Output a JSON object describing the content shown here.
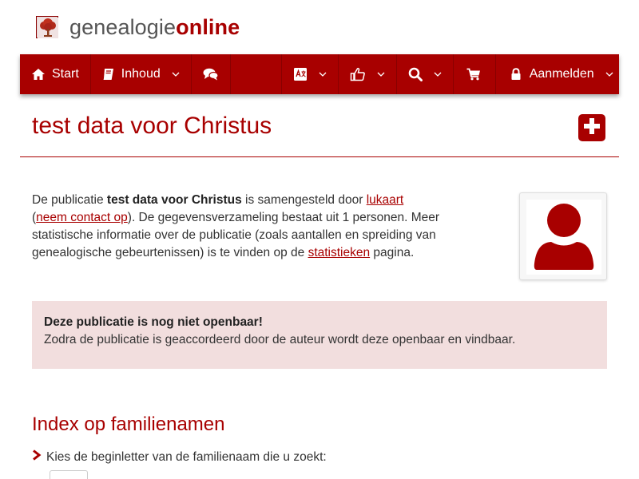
{
  "brand": {
    "name_part1": "genealogie",
    "name_part2": "online"
  },
  "nav": {
    "start": "Start",
    "inhoud": "Inhoud",
    "aanmelden": "Aanmelden"
  },
  "page": {
    "title": "test data voor Christus"
  },
  "intro": {
    "p1": "De publicatie ",
    "pub_name": "test data voor Christus",
    "p2": " is samengesteld door ",
    "author": "lukaart",
    "p3": " (",
    "contact": "neem contact op",
    "p4": "). De gegevensverzameling bestaat uit 1 personen. Meer statistische informatie over de publicatie (zoals aantallen en spreiding van genealogische gebeurtenissen) is te vinden op de ",
    "stats": "statistieken",
    "p5": " pagina."
  },
  "alert": {
    "title": "Deze publicatie is nog niet openbaar!",
    "body": "Zodra de publicatie is geaccordeerd door de auteur wordt deze openbaar en vindbaar."
  },
  "index": {
    "title": "Index op familienamen",
    "hint": "Kies de beginletter van de familienaam die u zoekt:"
  },
  "colors": {
    "brand": "#a80000",
    "alert_bg": "#f2dede"
  },
  "icons": [
    "home-icon",
    "book-icon",
    "comments-icon",
    "language-icon",
    "thumbs-up-icon",
    "search-icon",
    "cart-icon",
    "lock-icon",
    "chevron-down-icon",
    "plus-square-icon",
    "user-icon",
    "chevron-right-icon"
  ]
}
